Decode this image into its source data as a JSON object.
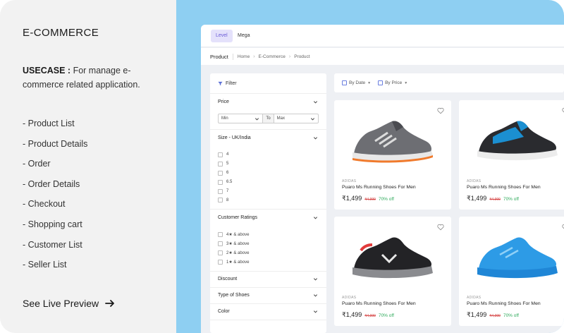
{
  "info": {
    "title": "E-COMMERCE",
    "usecase_label": "USECASE :",
    "usecase_text": "For manage e-commerce related application.",
    "features": [
      "- Product List",
      "- Product Details",
      "- Order",
      "- Order Details",
      "- Checkout",
      "- Shopping cart",
      "- Customer List",
      "- Seller List"
    ],
    "preview_label": "See Live Preview"
  },
  "app": {
    "tabs": [
      "Level",
      "Mega"
    ],
    "page_title": "Product",
    "breadcrumb": [
      "Home",
      "E-Commerce",
      "Product"
    ],
    "filter": {
      "header": "Filter",
      "price_title": "Price",
      "min_placeholder": "Min",
      "to_label": "To",
      "max_placeholder": "Max",
      "size_title": "Size - UK/India",
      "sizes": [
        "4",
        "5",
        "6",
        "6.5",
        "7",
        "8"
      ],
      "ratings_title": "Customer Ratings",
      "ratings": [
        "4★ & above",
        "3★ & above",
        "2★ & above",
        "1★ & above"
      ],
      "discount_title": "Discount",
      "type_title": "Type of Shoes",
      "color_title": "Color"
    },
    "sort": {
      "by_date": "By Date",
      "by_price": "By Price"
    },
    "products": [
      {
        "brand": "ADIDAS",
        "name": "Puaro Ms Running Shoes For Men",
        "price": "₹1,499",
        "old_price": "₹4,999",
        "discount": "70% off",
        "shoe": "grey-orange"
      },
      {
        "brand": "ADIDAS",
        "name": "Puaro Ms Running Shoes For Men",
        "price": "₹1,499",
        "old_price": "₹4,999",
        "discount": "70% off",
        "shoe": "blue-black"
      },
      {
        "brand": "ADIDAS",
        "name": "Puaro Ms Running Shoes For Men",
        "price": "₹1,499",
        "old_price": "₹4,999",
        "discount": "70% off",
        "shoe": "black-red"
      },
      {
        "brand": "ADIDAS",
        "name": "Puaro Ms Running Shoes For Men",
        "price": "₹1,499",
        "old_price": "₹4,999",
        "discount": "70% off",
        "shoe": "sky-blue"
      }
    ]
  }
}
